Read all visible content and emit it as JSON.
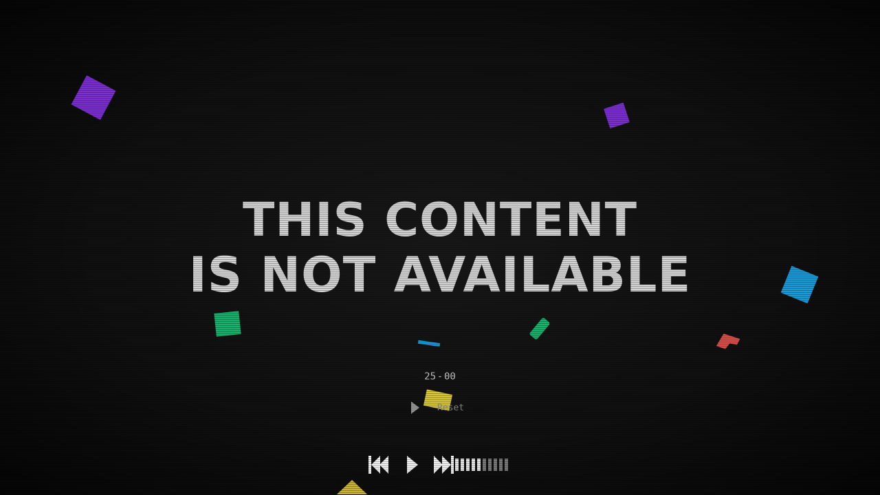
{
  "message": {
    "line1": "THIS CONTENT",
    "line2": "IS NOT AVAILABLE"
  },
  "timer": {
    "minutes": "25",
    "separator": "-",
    "seconds": "00"
  },
  "controls": {
    "reset_label": "Reset",
    "volume": {
      "level": 5,
      "max": 10
    }
  },
  "icons": {
    "rewind": "rewind-icon",
    "play": "play-icon",
    "fast_forward": "fast-forward-icon",
    "reset_play": "play-icon"
  },
  "colors": {
    "background": "#0b0b0b",
    "headline": "#d4d4d4",
    "confetti_purple": "#7b2fd0",
    "confetti_blue": "#1a9ad6",
    "confetti_green": "#18b06a",
    "confetti_red": "#d9504a",
    "confetti_yellow": "#d8c63a"
  }
}
